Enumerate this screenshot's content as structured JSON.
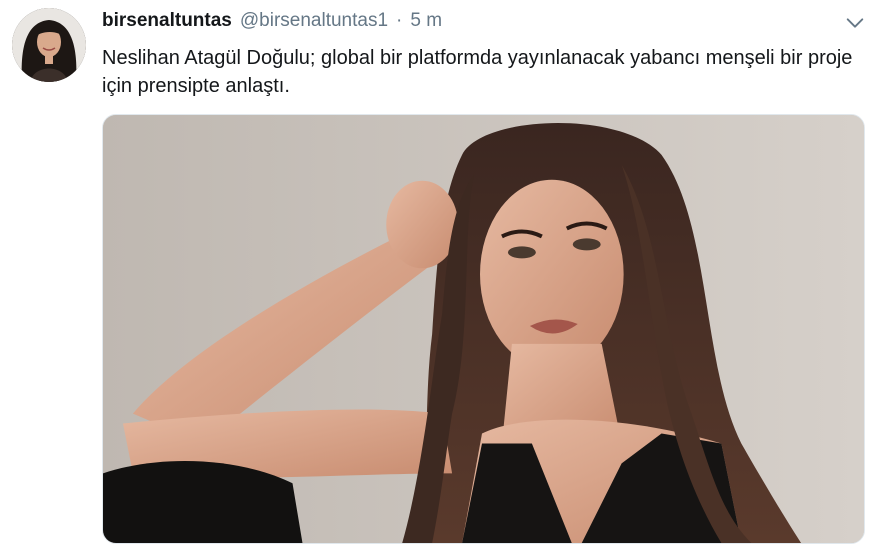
{
  "tweet": {
    "display_name": "birsenaltuntas",
    "handle": "@birsenaltuntas1",
    "separator": "·",
    "time": "5 m",
    "text": "Neslihan Atagül Doğulu; global bir platformda yayınlanacak yabancı menşeli bir proje için prensipte anlaştı.",
    "avatar_icon": "profile-photo",
    "menu_icon": "chevron-down-icon"
  },
  "colors": {
    "text": "#14171a",
    "secondary": "#657786",
    "border": "#e1e8ed"
  }
}
